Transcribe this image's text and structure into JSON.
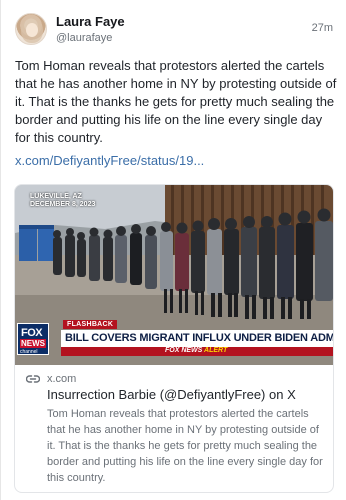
{
  "post": {
    "author_name": "Laura Faye",
    "author_handle": "@laurafaye",
    "timestamp": "27m",
    "text": "Tom Homan reveals that protestors alerted the cartels that he has another home in NY by protesting outside of it. That is the thanks he gets for pretty much sealing the border and putting his life on the line every single day for this country.",
    "link_text": "x.com/DefiyantlyFree/status/19..."
  },
  "card": {
    "image": {
      "dateline_place": "LUKEVILLE, AZ",
      "dateline_date": "DECEMBER 8, 2023",
      "flashback_label": "FLASHBACK",
      "headline": "BILL COVERS MIGRANT INFLUX UNDER BIDEN ADMIN",
      "network_label": "FOX NEWS",
      "alert_label": "ALERT",
      "logo_top": "FOX",
      "logo_bottom": "NEWS",
      "logo_channel": "channel"
    },
    "source_domain": "x.com",
    "title": "Insurrection Barbie (@DefiyantlyFree) on X",
    "description": "Tom Homan reveals that protestors alerted the cartels that he has another home in NY by protesting outside of it. That is the thanks he gets for pretty much sealing the border and putting his life on the line every single day for this country."
  },
  "colors": {
    "link": "#3b6ea8",
    "fox_red": "#b3121f",
    "fox_navy": "#0b2d66"
  },
  "icons": {
    "link_icon": "chain-link-icon"
  }
}
